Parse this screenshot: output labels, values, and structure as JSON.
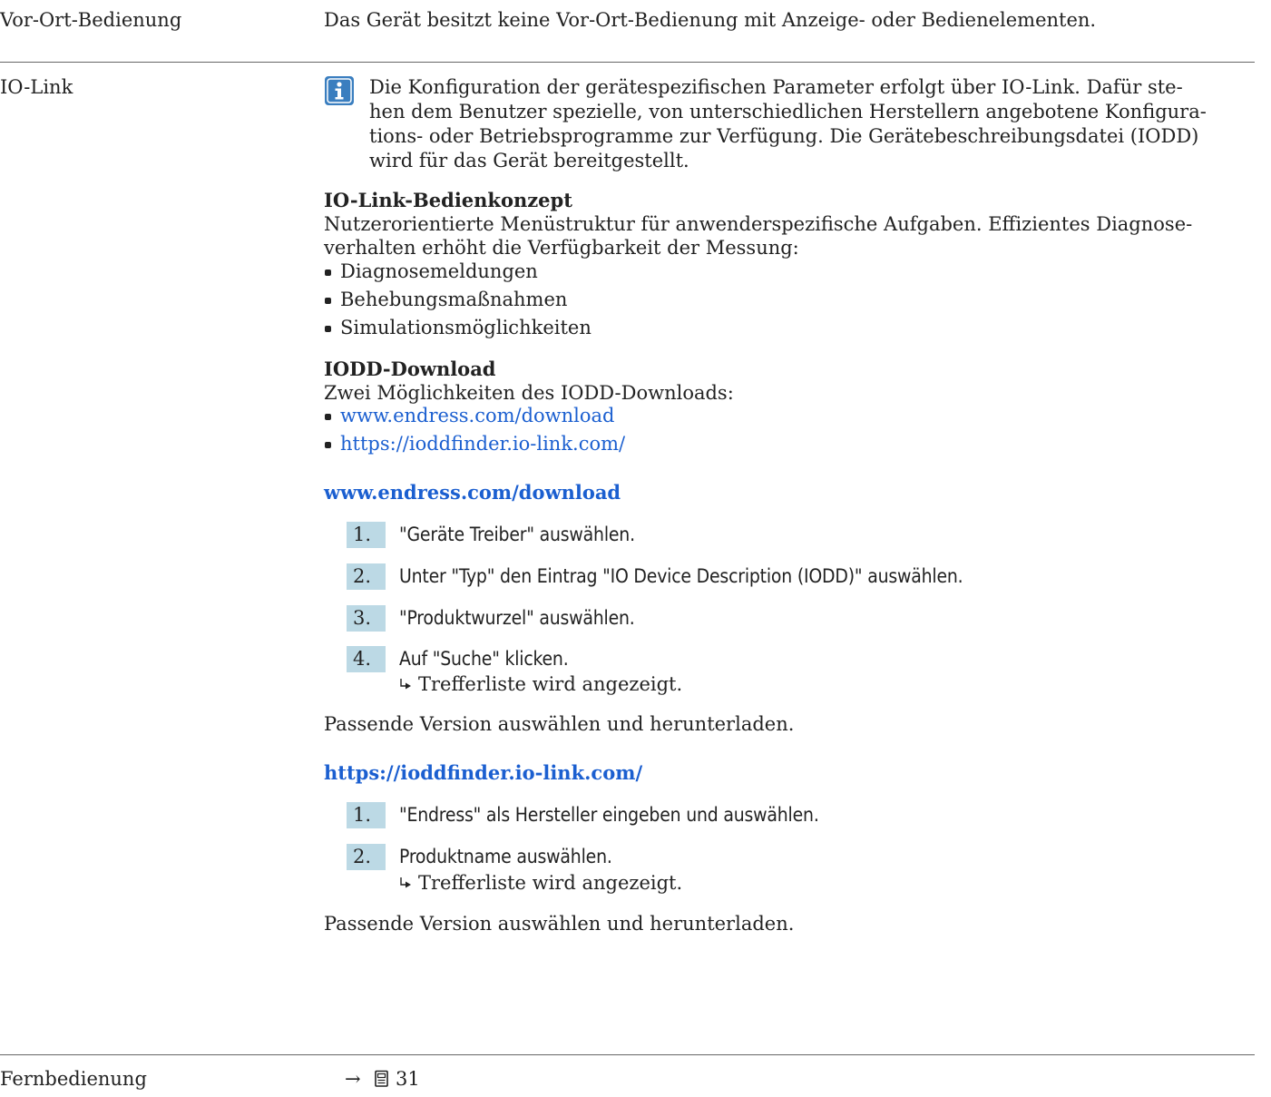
{
  "rows": [
    {
      "label": "Vor-Ort-Bedienung",
      "text": "Das Gerät besitzt keine Vor-Ort-Bedienung mit Anzeige- oder Bedienelementen."
    },
    {
      "label": "IO-Link"
    },
    {
      "label": "Fernbedienung",
      "ref_arrow": "→",
      "ref_page": "31"
    }
  ],
  "io_link": {
    "info_lines": [
      "Die Konfiguration der gerätespezifischen Parameter erfolgt über IO-Link. Dafür ste-",
      "hen dem Benutzer spezielle, von unterschiedlichen Herstellern angebotene Konfigura-",
      "tions- oder Betriebsprogramme zur Verfügung. Die Gerätebeschreibungsdatei (IODD)",
      "wird für das Gerät bereitgestellt."
    ],
    "concept": {
      "title": "IO-Link-Bedienkonzept",
      "lines": [
        "Nutzerorientierte Menüstruktur für anwenderspezifische Aufgaben. Effizientes Diagnose-",
        "verhalten erhöht die Verfügbarkeit der Messung:"
      ],
      "bullets": [
        "Diagnosemeldungen",
        "Behebungsmaßnahmen",
        "Simulationsmöglichkeiten"
      ]
    },
    "download": {
      "title": "IODD-Download",
      "intro": "Zwei Möglichkeiten des IODD-Downloads:",
      "links": [
        "www.endress.com/download",
        "https://ioddfinder.io-link.com/"
      ]
    },
    "procedure_endress": {
      "title": "www.endress.com/download",
      "steps": [
        {
          "num": "1.",
          "text": "\"Geräte Treiber\" auswählen."
        },
        {
          "num": "2.",
          "text": "Unter \"Typ\" den Eintrag \"IO Device Description (IODD)\" auswählen."
        },
        {
          "num": "3.",
          "text": "\"Produktwurzel\" auswählen."
        },
        {
          "num": "4.",
          "text": "Auf \"Suche\" klicken."
        }
      ],
      "result": "Trefferliste wird angezeigt.",
      "closing": "Passende Version auswählen und herunterladen."
    },
    "procedure_ioddfinder": {
      "title": "https://ioddfinder.io-link.com/",
      "steps": [
        {
          "num": "1.",
          "text": "\"Endress\" als Hersteller eingeben und auswählen."
        },
        {
          "num": "2.",
          "text": "Produktname auswählen."
        }
      ],
      "result": "Trefferliste wird angezeigt.",
      "closing": "Passende Version auswählen und herunterladen."
    }
  },
  "colors": {
    "text": "#222222",
    "link": "#1b5fd0",
    "step_box": "#bcd9e5",
    "info_icon": "#3a7ebf",
    "rule": "#666666"
  },
  "icons": {
    "info": "info-icon",
    "result": "result-arrow-icon",
    "page_ref": "book-icon"
  }
}
